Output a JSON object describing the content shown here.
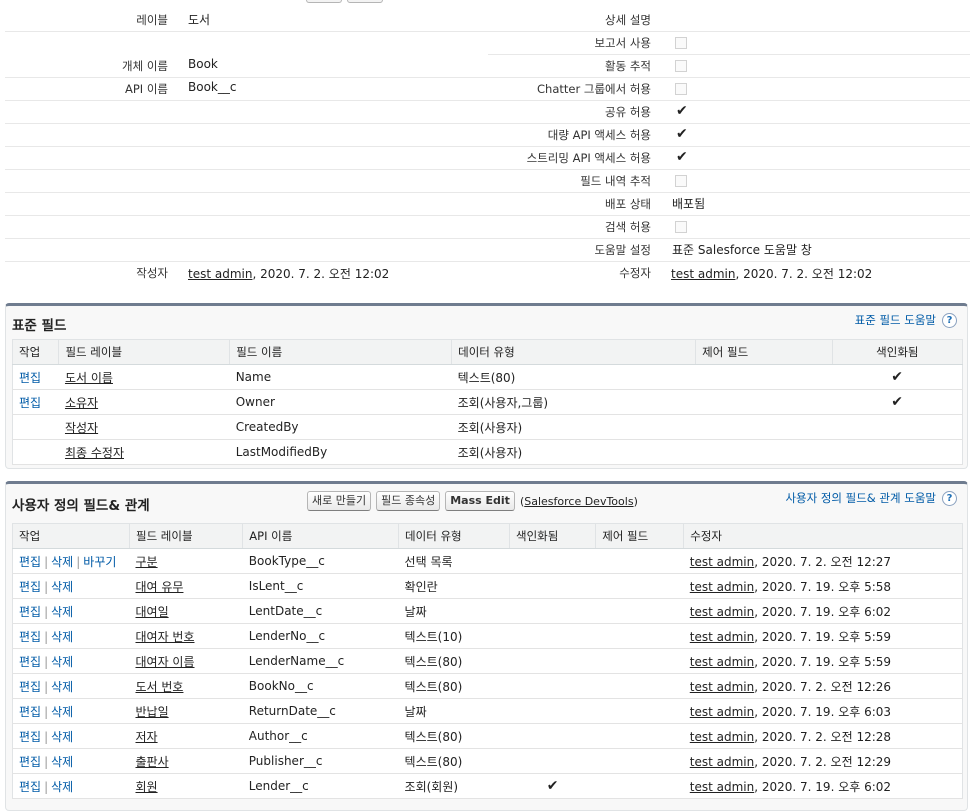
{
  "details": {
    "left": [
      {
        "label": "레이블",
        "value": "도서"
      },
      {
        "label": "개체 이름",
        "value": "Book"
      },
      {
        "label": "API 이름",
        "value": "Book__c"
      }
    ],
    "right": [
      {
        "label": "상세 설명",
        "value": "",
        "type": "text"
      },
      {
        "label": "보고서 사용",
        "type": "empty"
      },
      {
        "label": "활동 추적",
        "type": "empty"
      },
      {
        "label": "Chatter 그룹에서 허용",
        "type": "empty"
      },
      {
        "label": "공유 허용",
        "type": "check"
      },
      {
        "label": "대량 API 액세스 허용",
        "type": "check"
      },
      {
        "label": "스트리밍 API 액세스 허용",
        "type": "check"
      },
      {
        "label": "필드 내역 추적",
        "type": "empty"
      },
      {
        "label": "배포 상태",
        "value": "배포됨",
        "type": "text"
      },
      {
        "label": "검색 허용",
        "type": "empty"
      },
      {
        "label": "도움말 설정",
        "value": "표준 Salesforce 도움말 창",
        "type": "text"
      }
    ],
    "created_label": "작성자",
    "created_user": "test admin",
    "created_date": ", 2020. 7. 2. 오전 12:02",
    "modified_label": "수정자",
    "modified_user": "test admin",
    "modified_date": ", 2020. 7. 2. 오전 12:02"
  },
  "standard": {
    "title": "표준 필드",
    "help": "표준 필드 도움말",
    "columns": [
      "작업",
      "필드 레이블",
      "필드 이름",
      "데이터 유형",
      "제어 필드",
      "색인화됨"
    ],
    "rows": [
      {
        "action": "편집",
        "label": "도서 이름",
        "name": "Name",
        "type": "텍스트(80)",
        "indexed": true
      },
      {
        "action": "편집",
        "label": "소유자",
        "name": "Owner",
        "type": "조회(사용자,그룹)",
        "indexed": true
      },
      {
        "action": "",
        "label": "작성자",
        "name": "CreatedBy",
        "type": "조회(사용자)",
        "indexed": false
      },
      {
        "action": "",
        "label": "최종 수정자",
        "name": "LastModifiedBy",
        "type": "조회(사용자)",
        "indexed": false
      }
    ]
  },
  "custom": {
    "title": "사용자 정의 필드& 관계",
    "help": "사용자 정의 필드& 관계 도움말",
    "btn_new": "새로 만들기",
    "btn_dep": "필드 종속성",
    "btn_mass": "Mass Edit",
    "devtools_open": "(",
    "devtools": "Salesforce DevTools",
    "devtools_close": ")",
    "columns": [
      "작업",
      "필드 레이블",
      "API 이름",
      "데이터 유형",
      "색인화됨",
      "제어 필드",
      "수정자"
    ],
    "act_edit": "편집",
    "act_del": "삭제",
    "act_swap": "바꾸기",
    "act_sep": "|",
    "rows": [
      {
        "swap": true,
        "label": "구분",
        "api": "BookType__c",
        "type": "선택 목록",
        "indexed": false,
        "user": "test admin",
        "date": ", 2020. 7. 2. 오전 12:27"
      },
      {
        "swap": false,
        "label": "대여 유무",
        "api": "IsLent__c",
        "type": "확인란",
        "indexed": false,
        "user": "test admin",
        "date": ", 2020. 7. 19. 오후 5:58"
      },
      {
        "swap": false,
        "label": "대여일",
        "api": "LentDate__c",
        "type": "날짜",
        "indexed": false,
        "user": "test admin",
        "date": ", 2020. 7. 19. 오후 6:02"
      },
      {
        "swap": false,
        "label": "대여자 번호",
        "api": "LenderNo__c",
        "type": "텍스트(10)",
        "indexed": false,
        "user": "test admin",
        "date": ", 2020. 7. 19. 오후 5:59"
      },
      {
        "swap": false,
        "label": "대여자 이름",
        "api": "LenderName__c",
        "type": "텍스트(80)",
        "indexed": false,
        "user": "test admin",
        "date": ", 2020. 7. 19. 오후 5:59"
      },
      {
        "swap": false,
        "label": "도서 번호",
        "api": "BookNo__c",
        "type": "텍스트(80)",
        "indexed": false,
        "user": "test admin",
        "date": ", 2020. 7. 2. 오전 12:26"
      },
      {
        "swap": false,
        "label": "반납일",
        "api": "ReturnDate__c",
        "type": "날짜",
        "indexed": false,
        "user": "test admin",
        "date": ", 2020. 7. 19. 오후 6:03"
      },
      {
        "swap": false,
        "label": "저자",
        "api": "Author__c",
        "type": "텍스트(80)",
        "indexed": false,
        "user": "test admin",
        "date": ", 2020. 7. 2. 오전 12:28"
      },
      {
        "swap": false,
        "label": "출판사",
        "api": "Publisher__c",
        "type": "텍스트(80)",
        "indexed": false,
        "user": "test admin",
        "date": ", 2020. 7. 2. 오전 12:29"
      },
      {
        "swap": false,
        "label": "회원",
        "api": "Lender__c",
        "type": "조회(회원)",
        "indexed": true,
        "user": "test admin",
        "date": ", 2020. 7. 19. 오후 6:02"
      }
    ]
  },
  "icons": {
    "check": "✔",
    "help": "?"
  }
}
